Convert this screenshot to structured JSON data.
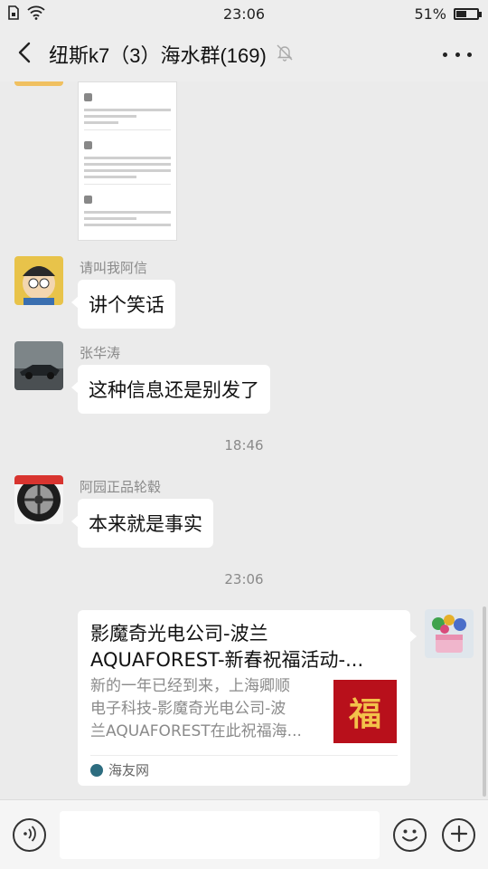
{
  "status_bar": {
    "time": "23:06",
    "battery_text": "51%",
    "battery_level": 0.51
  },
  "header": {
    "title": "纽斯k7（3）海水群(169)"
  },
  "messages": [
    {
      "sender": "请叫我阿信",
      "text": "讲个笑话"
    },
    {
      "sender": "张华涛",
      "text": "这种信息还是别发了"
    },
    {
      "sender": "阿园正品轮毂",
      "text": "本来就是事实"
    }
  ],
  "timestamps": [
    "18:46",
    "23:06"
  ],
  "link_card": {
    "title_line1": "影魔奇光电公司-波兰",
    "title_line2": "AQUAFOREST-新春祝福活动-...",
    "desc_line1": "新的一年已经到来，上海卿顺",
    "desc_line2": "电子科技-影魔奇光电公司-波",
    "desc_line3": "兰AQUAFOREST在此祝福海...",
    "thumb_char": "福",
    "source": "海友网"
  },
  "input": {
    "value": "",
    "placeholder": ""
  },
  "colors": {
    "background": "#ebebeb",
    "bubble": "#ffffff",
    "meta_text": "#8a8a8a"
  },
  "icons": [
    "back-arrow-icon",
    "mute-bell-icon",
    "more-icon",
    "voice-icon",
    "emoji-icon",
    "plus-icon",
    "wifi-icon",
    "sim-icon"
  ]
}
